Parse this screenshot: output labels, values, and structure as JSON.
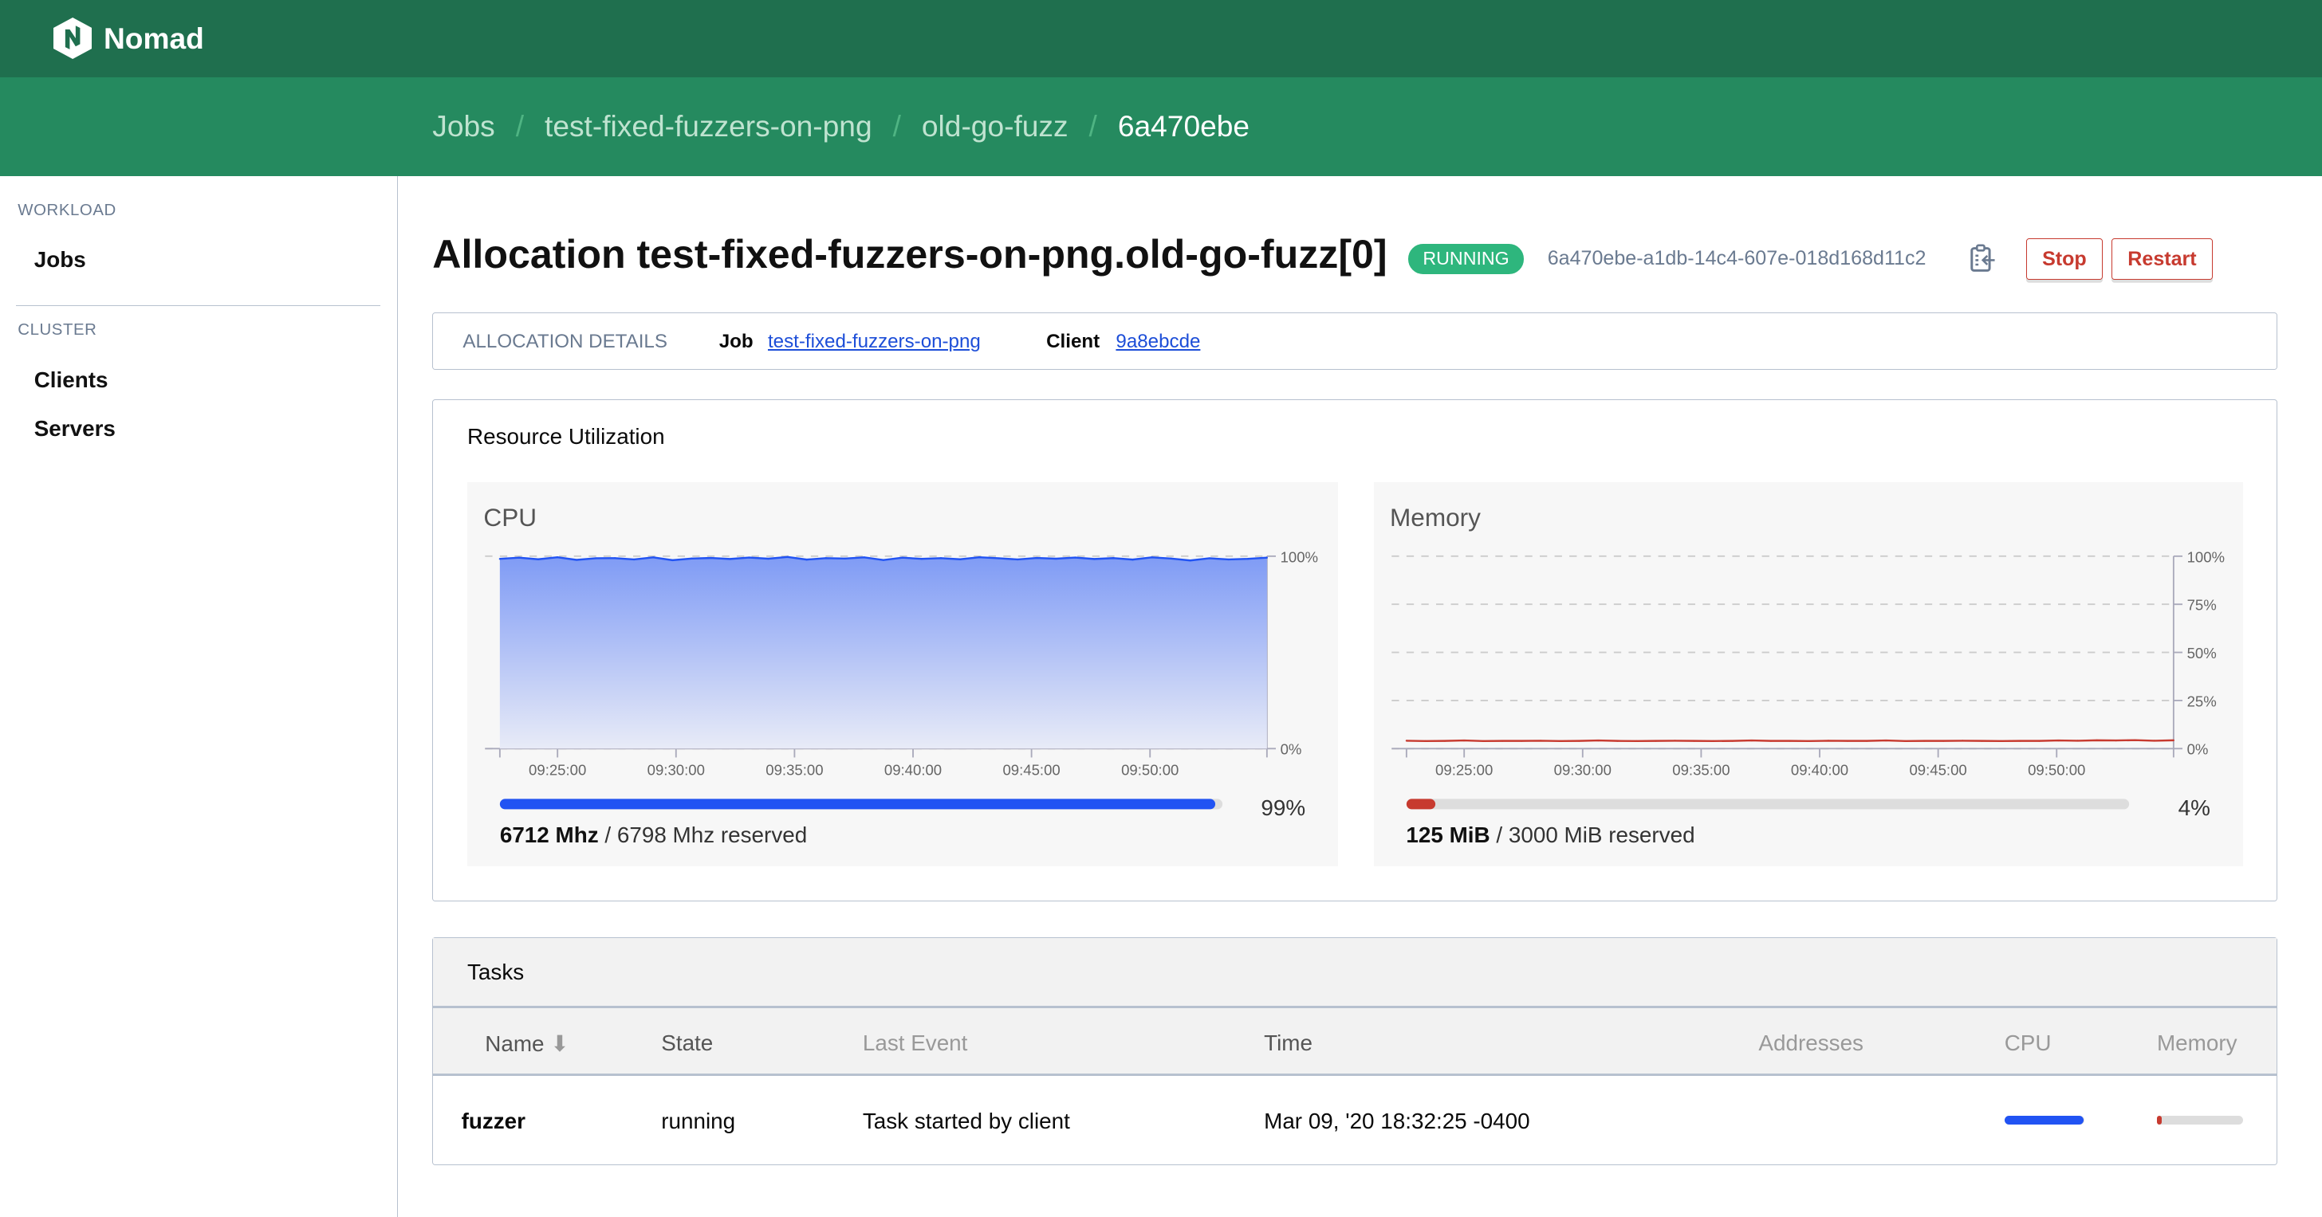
{
  "app": {
    "name": "Nomad",
    "logo_icon": "nomad-logo-icon"
  },
  "breadcrumb": [
    "Jobs",
    "test-fixed-fuzzers-on-png",
    "old-go-fuzz",
    "6a470ebe"
  ],
  "sidebar": {
    "sections": [
      {
        "heading": "WORKLOAD",
        "items": [
          "Jobs"
        ]
      },
      {
        "heading": "CLUSTER",
        "items": [
          "Clients",
          "Servers"
        ]
      }
    ]
  },
  "allocation": {
    "title": "Allocation test-fixed-fuzzers-on-png.old-go-fuzz[0]",
    "status": "RUNNING",
    "id": "6a470ebe-a1db-14c4-607e-018d168d11c2",
    "copy_icon": "clipboard-copy-icon",
    "stop_label": "Stop",
    "restart_label": "Restart"
  },
  "details": {
    "heading": "ALLOCATION DETAILS",
    "job_label": "Job",
    "job_value": "test-fixed-fuzzers-on-png",
    "client_label": "Client",
    "client_value": "9a8ebcde"
  },
  "resources": {
    "title": "Resource Utilization",
    "cpu": {
      "title": "CPU",
      "percent": "99%",
      "used": "6712 Mhz",
      "reserved": "/ 6798 Mhz reserved",
      "fraction": 0.99
    },
    "memory": {
      "title": "Memory",
      "percent": "4%",
      "used": "125 MiB",
      "reserved": "/ 3000 MiB reserved",
      "fraction": 0.04
    }
  },
  "colors": {
    "brand_dark": "#1f6f4e",
    "brand": "#258a5f",
    "running": "#2eb67d",
    "danger": "#c73a2f",
    "cpu": "#2153f3",
    "memory": "#c73a2f"
  },
  "chart_data": [
    {
      "type": "area",
      "title": "CPU",
      "x_range": [
        "09:22:34",
        "09:54:56"
      ],
      "x_ticks": [
        "09:25:00",
        "09:30:00",
        "09:35:00",
        "09:40:00",
        "09:45:00",
        "09:50:00"
      ],
      "y_ticks": [
        "0%",
        "100%"
      ],
      "ylim": [
        0,
        100
      ],
      "values": [
        98.6,
        99.2,
        98.4,
        99.5,
        98.1,
        98.9,
        99.0,
        98.3,
        99.4,
        97.9,
        98.8,
        99.1,
        98.5,
        99.3,
        98.7,
        99.6,
        98.2,
        99.0,
        98.8,
        99.4,
        98.0,
        99.2,
        98.6,
        99.0,
        98.4,
        99.5,
        98.9,
        98.3,
        99.1,
        98.7,
        99.3,
        98.5,
        99.0,
        98.2,
        99.4,
        98.8,
        97.8,
        98.9,
        98.3,
        98.6,
        99.2
      ]
    },
    {
      "type": "line",
      "title": "Memory",
      "x_range": [
        "09:22:34",
        "09:54:56"
      ],
      "x_ticks": [
        "09:25:00",
        "09:30:00",
        "09:35:00",
        "09:40:00",
        "09:45:00",
        "09:50:00"
      ],
      "y_ticks": [
        "0%",
        "25%",
        "50%",
        "75%",
        "100%"
      ],
      "ylim": [
        0,
        100
      ],
      "values": [
        4.1,
        3.9,
        4.0,
        4.2,
        3.9,
        4.0,
        4.0,
        4.1,
        3.9,
        4.0,
        4.2,
        4.0,
        3.9,
        4.0,
        4.1,
        4.0,
        3.9,
        4.0,
        4.2,
        4.0,
        4.0,
        3.9,
        4.1,
        4.0,
        4.0,
        4.2,
        3.9,
        4.0,
        4.0,
        4.1,
        4.0,
        3.9,
        4.0,
        4.0,
        4.2,
        4.1,
        4.3,
        4.2,
        4.4,
        4.1,
        4.3
      ]
    }
  ],
  "tasks": {
    "title": "Tasks",
    "columns": [
      "Name",
      "State",
      "Last Event",
      "Time",
      "Addresses",
      "CPU",
      "Memory"
    ],
    "sort_icon": "arrow-down-icon",
    "rows": [
      {
        "name": "fuzzer",
        "state": "running",
        "last_event": "Task started by client",
        "time": "Mar 09, '20 18:32:25 -0400",
        "addresses": "",
        "cpu_fraction": 0.99,
        "memory_fraction": 0.04
      }
    ]
  }
}
